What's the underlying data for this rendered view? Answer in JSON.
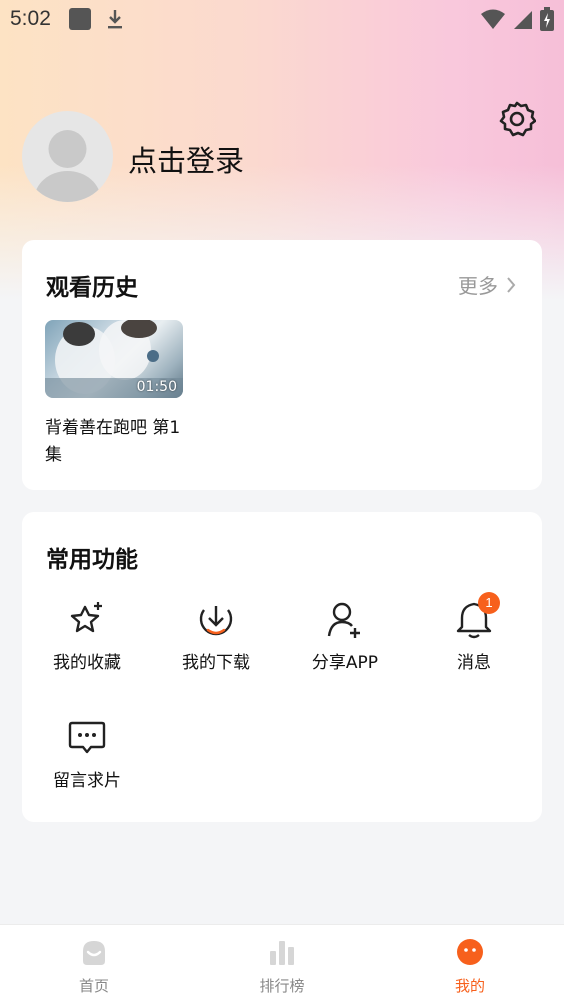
{
  "status_bar": {
    "time": "5:02"
  },
  "profile": {
    "login_text": "点击登录"
  },
  "history": {
    "title": "观看历史",
    "more_label": "更多",
    "items": [
      {
        "title": "背着善在跑吧 第1集",
        "duration": "01:50"
      }
    ]
  },
  "functions": {
    "title": "常用功能",
    "items": [
      {
        "label": "我的收藏",
        "icon": "star-icon"
      },
      {
        "label": "我的下载",
        "icon": "download-icon"
      },
      {
        "label": "分享APP",
        "icon": "add-user-icon"
      },
      {
        "label": "消息",
        "icon": "bell-icon",
        "badge": "1"
      },
      {
        "label": "留言求片",
        "icon": "message-icon"
      }
    ]
  },
  "tabbar": {
    "items": [
      {
        "label": "首页",
        "icon": "home-icon"
      },
      {
        "label": "排行榜",
        "icon": "chart-icon"
      },
      {
        "label": "我的",
        "icon": "profile-icon",
        "active": true
      }
    ]
  },
  "colors": {
    "accent": "#f7601c",
    "inactive": "#888888"
  }
}
